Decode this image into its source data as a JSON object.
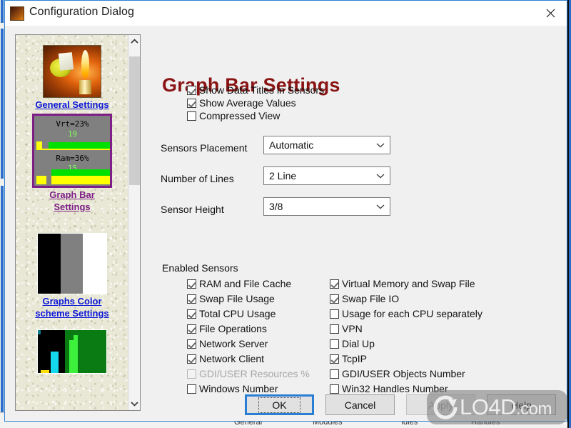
{
  "window": {
    "title": "Configuration Dialog",
    "close_label": "✕",
    "icon": "candle-gear-icon"
  },
  "background_window": {
    "tabs": [
      "General",
      "Modules",
      "Idles",
      "Handles"
    ]
  },
  "sidebar": {
    "items": [
      {
        "label": "General Settings",
        "thumb": "candle-icon",
        "state": "unvisited",
        "color": "#0b16d6"
      },
      {
        "label_line1": "Graph Bar",
        "label_line2": "Settings",
        "thumb": "graph-bar-preview",
        "state": "selected",
        "color": "#7d1f86"
      },
      {
        "label_line1": "Graphs Color",
        "label_line2": "scheme Settings",
        "thumb": "color-scheme-preview",
        "state": "unvisited",
        "color": "#0b16d6"
      },
      {
        "label": "",
        "thumb": "green-graph-preview",
        "state": "unvisited",
        "color": "#0b16d6"
      }
    ],
    "graph_bar_preview": {
      "rows": [
        {
          "title": "Vrt=23%",
          "value_green": "19",
          "value_yellow": "4"
        },
        {
          "title": "Ram=36%",
          "value_green": "15",
          "value_yellow": "22"
        }
      ]
    },
    "scrollbar": {
      "up": "⌃",
      "down": "⌄"
    }
  },
  "main": {
    "title": "Graph Bar Settings",
    "title_color": "#8a1414",
    "display_options": [
      {
        "label": "Show Data Titles in Sensors",
        "checked": true,
        "enabled": true
      },
      {
        "label": "Show Average Values",
        "checked": true,
        "enabled": true
      },
      {
        "label": "Compressed View",
        "checked": false,
        "enabled": true
      }
    ],
    "fields": [
      {
        "label": "Sensors Placement",
        "value": "Automatic"
      },
      {
        "label": "Number of Lines",
        "value": "2 Line"
      },
      {
        "label": "Sensor Height",
        "value": "3/8"
      }
    ],
    "group_title": "Enabled Sensors",
    "sensors_left": [
      {
        "label": "RAM and  File Cache",
        "checked": true,
        "enabled": true
      },
      {
        "label": "Swap File Usage",
        "checked": true,
        "enabled": true
      },
      {
        "label": "Total CPU Usage",
        "checked": true,
        "enabled": true
      },
      {
        "label": "File Operations",
        "checked": true,
        "enabled": true
      },
      {
        "label": "Network Server",
        "checked": true,
        "enabled": true
      },
      {
        "label": "Network Client",
        "checked": true,
        "enabled": true
      },
      {
        "label": "GDI/USER Resources %",
        "checked": false,
        "enabled": false
      },
      {
        "label": "Windows Number",
        "checked": false,
        "enabled": true
      }
    ],
    "sensors_right": [
      {
        "label": "Virtual Memory and Swap File",
        "checked": true,
        "enabled": true
      },
      {
        "label": "Swap File IO",
        "checked": true,
        "enabled": true
      },
      {
        "label": "Usage for each CPU separately",
        "checked": false,
        "enabled": true
      },
      {
        "label": "VPN",
        "checked": false,
        "enabled": true
      },
      {
        "label": "Dial Up",
        "checked": false,
        "enabled": true
      },
      {
        "label": "TcpIP",
        "checked": true,
        "enabled": true
      },
      {
        "label": "GDI/USER Objects Number",
        "checked": false,
        "enabled": true
      },
      {
        "label": "Win32 Handles Number",
        "checked": false,
        "enabled": true
      }
    ]
  },
  "buttons": [
    {
      "label": "OK",
      "state": "focused"
    },
    {
      "label": "Cancel",
      "state": "normal"
    },
    {
      "label": "Apply",
      "state": "disabled"
    },
    {
      "label": "Help",
      "state": "normal"
    }
  ],
  "watermark": {
    "text": "LO4D",
    "suffix": ".com"
  }
}
